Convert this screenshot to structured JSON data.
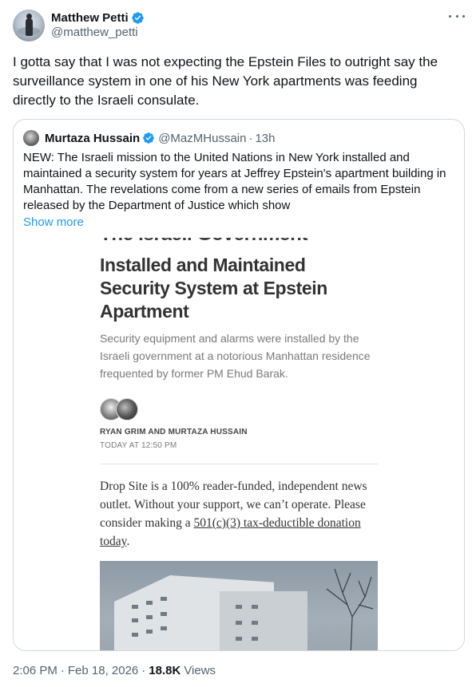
{
  "author": {
    "name": "Matthew Petti",
    "handle": "@matthew_petti",
    "verified_icon": "verified-badge-icon",
    "more_icon": "more-options-icon"
  },
  "tweet": {
    "text": "I gotta say that I was not expecting the Epstein Files to outright say the surveillance system in one of his New York apartments was feeding directly to the Israeli consulate."
  },
  "quote": {
    "name": "Murtaza Hussain",
    "handle": "@MazMHussain",
    "separator": "·",
    "time": "13h",
    "text": "NEW: The Israeli mission to the United Nations in New York installed and maintained a security system for years at Jeffrey Epstein's apartment building in Manhattan. The revelations come from a new series of emails from Epstein released by the Department of Justice which show",
    "show_more": "Show more",
    "article": {
      "cut_headline": "The Israeli Government",
      "title": "Installed and Maintained Security System at Epstein Apartment",
      "subtitle": "Security equipment and alarms were installed by the Israeli government at a notorious Manhattan residence frequented by former PM Ehud Barak.",
      "authors": "RYAN GRIM AND MURTAZA HUSSAIN",
      "date": "TODAY AT 12:50 PM",
      "body_pre": "Drop Site is a 100% reader-funded, independent news outlet. Without your support, we can’t operate. Please consider making a ",
      "body_link": "501(c)(3) tax-deductible donation today",
      "body_post": "."
    }
  },
  "footer": {
    "time": "2:06 PM",
    "separator": "·",
    "date": "Feb 18, 2026",
    "separator2": "·",
    "views_count": "18.8K",
    "views_label": "Views"
  },
  "colors": {
    "accent": "#1d9bf0",
    "text": "#0f1419",
    "muted": "#536471",
    "border": "#cfd9de"
  }
}
